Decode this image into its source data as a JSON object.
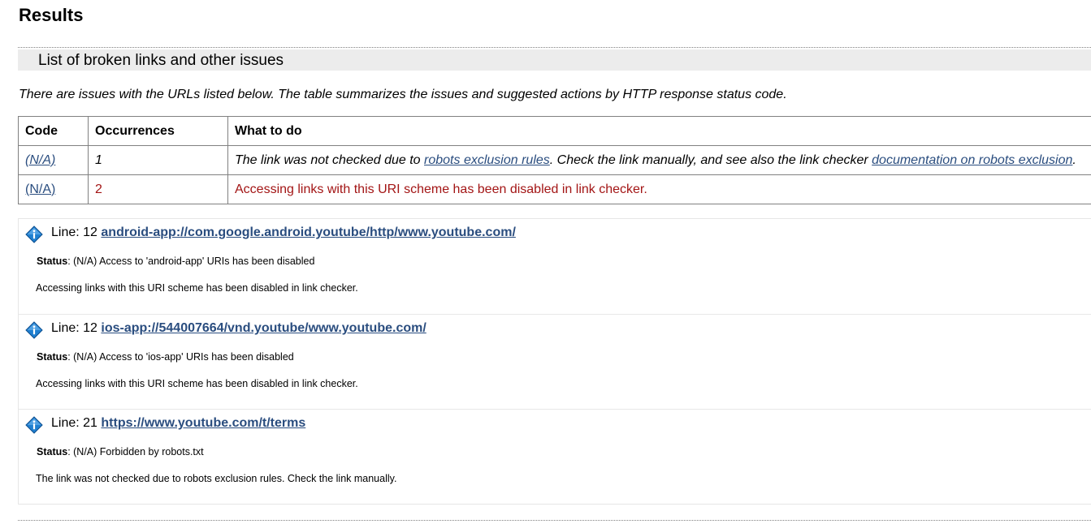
{
  "page_title": "Results",
  "section_title": "List of broken links and other issues",
  "intro": "There are issues with the URLs listed below. The table summarizes the issues and suggested actions by HTTP response status code.",
  "table": {
    "headers": [
      "Code",
      "Occurrences",
      "What to do"
    ],
    "rows": [
      {
        "code": "(N/A)",
        "occurrences": "1",
        "what_pre": "The link was not checked due to ",
        "link1": "robots exclusion rules",
        "what_mid": ". Check the link manually, and see also the link checker ",
        "link2": "documentation on robots exclusion",
        "what_post": "."
      },
      {
        "code": "(N/A)",
        "occurrences": "2",
        "what": "Accessing links with this URI scheme has been disabled in link checker."
      }
    ]
  },
  "issues": [
    {
      "line_label": "Line: 12",
      "url": "android-app://com.google.android.youtube/http/www.youtube.com/",
      "status_label": "Status",
      "status_text": ": (N/A) Access to 'android-app' URIs has been disabled",
      "message": "Accessing links with this URI scheme has been disabled in link checker."
    },
    {
      "line_label": "Line: 12",
      "url": "ios-app://544007664/vnd.youtube/www.youtube.com/",
      "status_label": "Status",
      "status_text": ": (N/A) Access to 'ios-app' URIs has been disabled",
      "message": "Accessing links with this URI scheme has been disabled in link checker."
    },
    {
      "line_label": "Line: 21",
      "url": "https://www.youtube.com/t/terms",
      "status_label": "Status",
      "status_text": ": (N/A) Forbidden by robots.txt",
      "message": "The link was not checked due to robots exclusion rules. Check the link manually."
    }
  ],
  "icons": {
    "issue_icon": "info-diamond-icon",
    "icon_color": "#1f7fd0"
  }
}
